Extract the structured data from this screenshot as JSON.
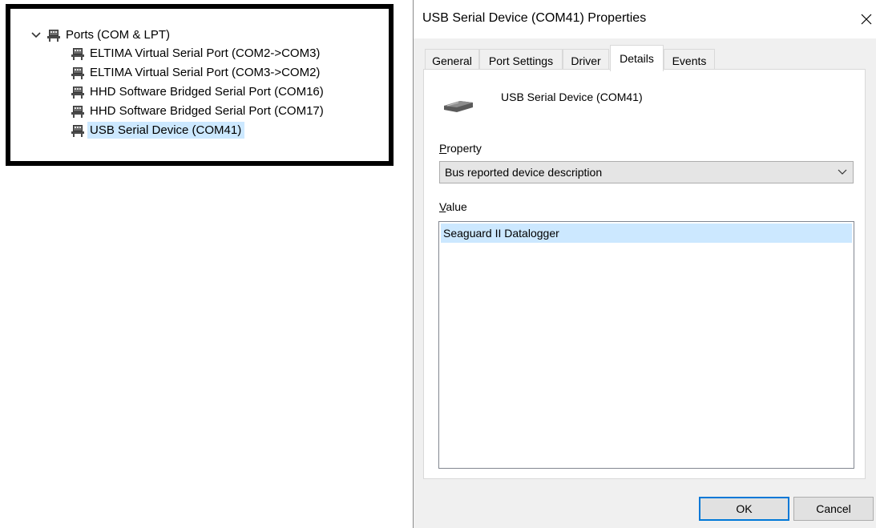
{
  "device_manager": {
    "category": "Ports (COM & LPT)",
    "items": [
      {
        "label": "ELTIMA Virtual Serial Port (COM2->COM3)"
      },
      {
        "label": "ELTIMA Virtual Serial Port (COM3->COM2)"
      },
      {
        "label": "HHD Software Bridged Serial Port (COM16)"
      },
      {
        "label": "HHD Software Bridged Serial Port (COM17)"
      },
      {
        "label": "USB Serial Device (COM41)",
        "selected": true
      }
    ]
  },
  "dialog": {
    "title": "USB Serial Device (COM41) Properties",
    "tabs": [
      {
        "label": "General"
      },
      {
        "label": "Port Settings"
      },
      {
        "label": "Driver"
      },
      {
        "label": "Details",
        "active": true
      },
      {
        "label": "Events"
      }
    ],
    "device_name": "USB Serial Device (COM41)",
    "property": {
      "label_accel": "P",
      "label_rest": "roperty",
      "selected_value": "Bus reported device description"
    },
    "value": {
      "label_accel": "V",
      "label_rest": "alue",
      "items": [
        "Seaguard II Datalogger"
      ]
    },
    "buttons": {
      "ok": "OK",
      "cancel": "Cancel"
    }
  },
  "colors": {
    "selection": "#cce8ff",
    "dialog_bg": "#f0f0f0",
    "default_button_border": "#0078d7"
  },
  "icons": {
    "expand": "chevron-down-icon",
    "port": "port-icon",
    "close": "close-icon",
    "device": "usb-serial-device-icon",
    "dropdown": "chevron-down-icon"
  }
}
